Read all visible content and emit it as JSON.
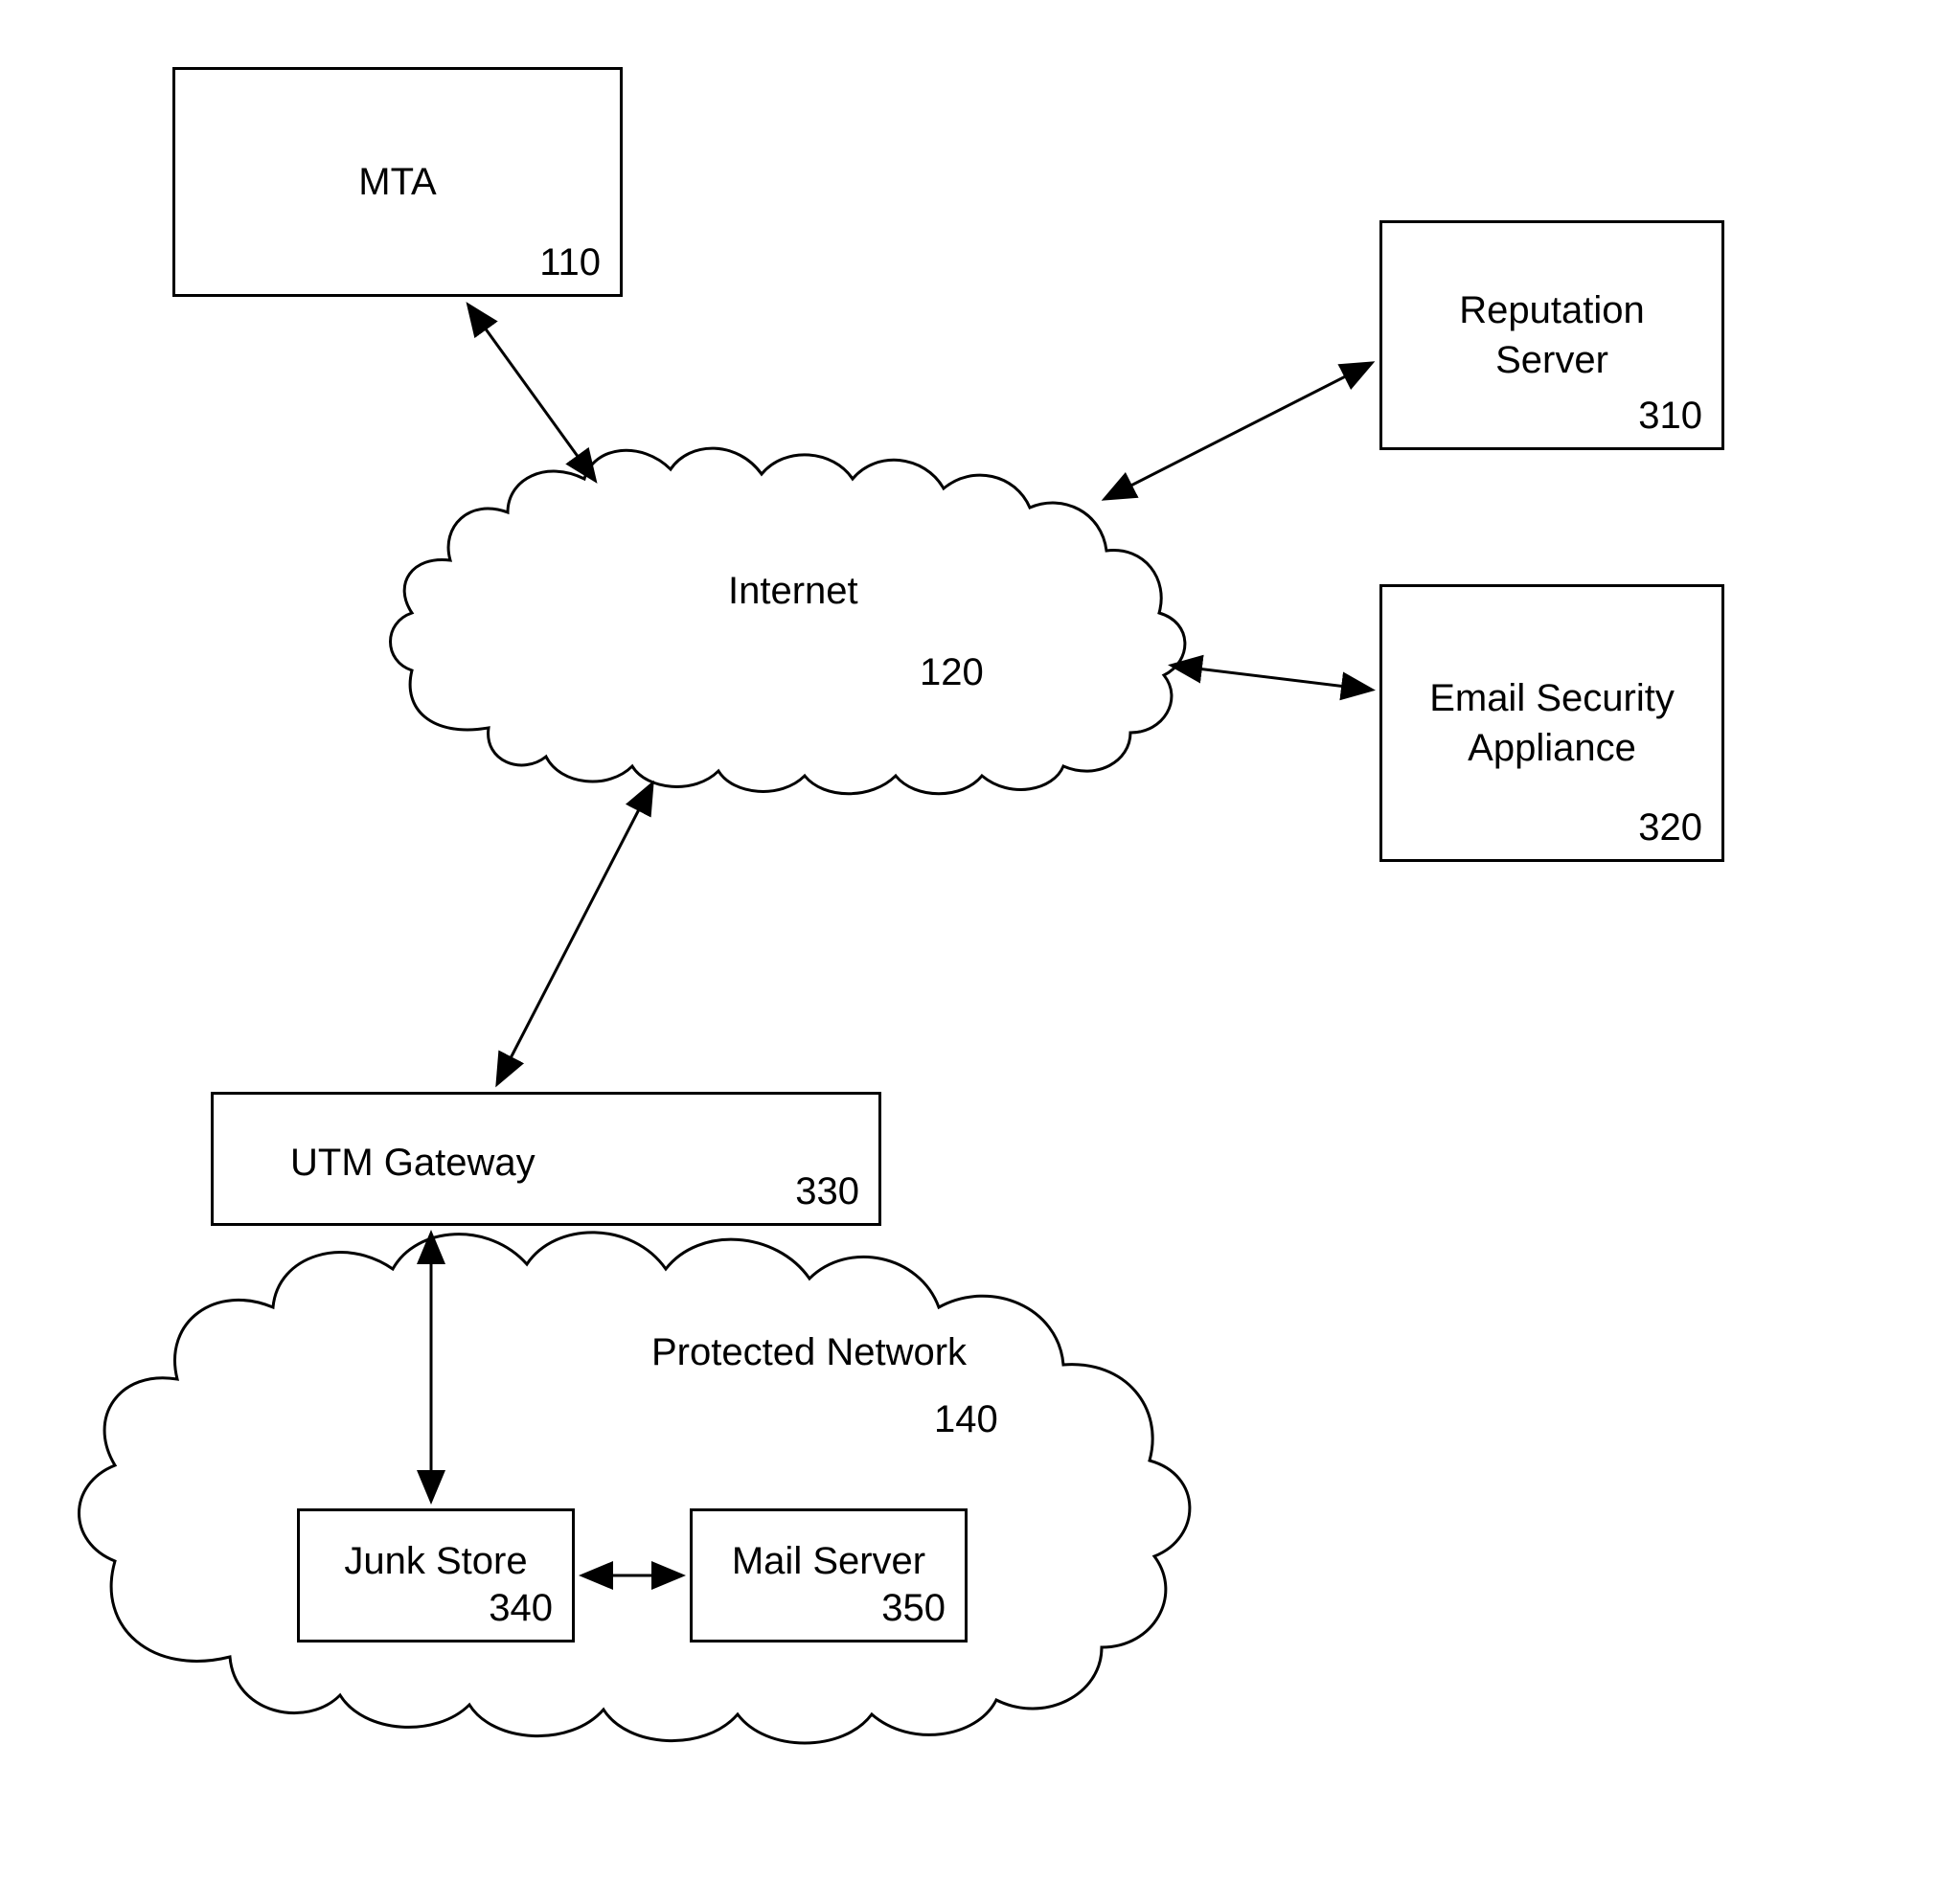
{
  "nodes": {
    "mta": {
      "label": "MTA",
      "number": "110"
    },
    "reputation_server": {
      "label": "Reputation\nServer",
      "number": "310"
    },
    "email_security": {
      "label": "Email Security\nAppliance",
      "number": "320"
    },
    "internet": {
      "label": "Internet",
      "number": "120"
    },
    "utm_gateway": {
      "label": "UTM Gateway",
      "number": "330"
    },
    "protected_network": {
      "label": "Protected Network",
      "number": "140"
    },
    "junk_store": {
      "label": "Junk Store",
      "number": "340"
    },
    "mail_server": {
      "label": "Mail Server",
      "number": "350"
    }
  }
}
